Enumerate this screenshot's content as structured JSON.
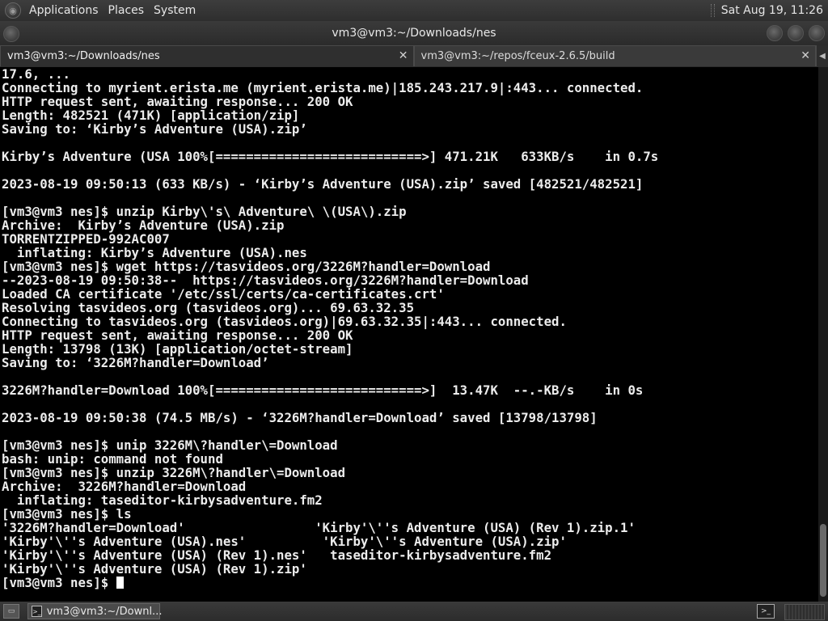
{
  "top_panel": {
    "menus": [
      "Applications",
      "Places",
      "System"
    ],
    "clock": "Sat Aug 19, 11:26"
  },
  "window": {
    "title": "vm3@vm3:~/Downloads/nes"
  },
  "tabs": [
    {
      "label": "vm3@vm3:~/Downloads/nes",
      "active": true
    },
    {
      "label": "vm3@vm3:~/repos/fceux-2.6.5/build",
      "active": false
    }
  ],
  "terminal": {
    "lines": [
      "17.6, ...",
      "Connecting to myrient.erista.me (myrient.erista.me)|185.243.217.9|:443... connected.",
      "HTTP request sent, awaiting response... 200 OK",
      "Length: 482521 (471K) [application/zip]",
      "Saving to: ‘Kirby’s Adventure (USA).zip’",
      "",
      "Kirby’s Adventure (USA 100%[===========================>] 471.21K   633KB/s    in 0.7s",
      "",
      "2023-08-19 09:50:13 (633 KB/s) - ‘Kirby’s Adventure (USA).zip’ saved [482521/482521]",
      "",
      "[vm3@vm3 nes]$ unzip Kirby\\'s\\ Adventure\\ \\(USA\\).zip",
      "Archive:  Kirby’s Adventure (USA).zip",
      "TORRENTZIPPED-992AC007",
      "  inflating: Kirby’s Adventure (USA).nes",
      "[vm3@vm3 nes]$ wget https://tasvideos.org/3226M?handler=Download",
      "--2023-08-19 09:50:38--  https://tasvideos.org/3226M?handler=Download",
      "Loaded CA certificate '/etc/ssl/certs/ca-certificates.crt'",
      "Resolving tasvideos.org (tasvideos.org)... 69.63.32.35",
      "Connecting to tasvideos.org (tasvideos.org)|69.63.32.35|:443... connected.",
      "HTTP request sent, awaiting response... 200 OK",
      "Length: 13798 (13K) [application/octet-stream]",
      "Saving to: ‘3226M?handler=Download’",
      "",
      "3226M?handler=Download 100%[===========================>]  13.47K  --.-KB/s    in 0s",
      "",
      "2023-08-19 09:50:38 (74.5 MB/s) - ‘3226M?handler=Download’ saved [13798/13798]",
      "",
      "[vm3@vm3 nes]$ unip 3226M\\?handler\\=Download",
      "bash: unip: command not found",
      "[vm3@vm3 nes]$ unzip 3226M\\?handler\\=Download",
      "Archive:  3226M?handler=Download",
      "  inflating: taseditor-kirbysadventure.fm2",
      "[vm3@vm3 nes]$ ls",
      "'3226M?handler=Download'                 'Kirby'\\''s Adventure (USA) (Rev 1).zip.1'",
      "'Kirby'\\''s Adventure (USA).nes'          'Kirby'\\''s Adventure (USA).zip'",
      "'Kirby'\\''s Adventure (USA) (Rev 1).nes'   taseditor-kirbysadventure.fm2",
      "'Kirby'\\''s Adventure (USA) (Rev 1).zip'"
    ],
    "prompt": "[vm3@vm3 nes]$ "
  },
  "bottom_panel": {
    "task_label": "vm3@vm3:~/Downl..."
  }
}
